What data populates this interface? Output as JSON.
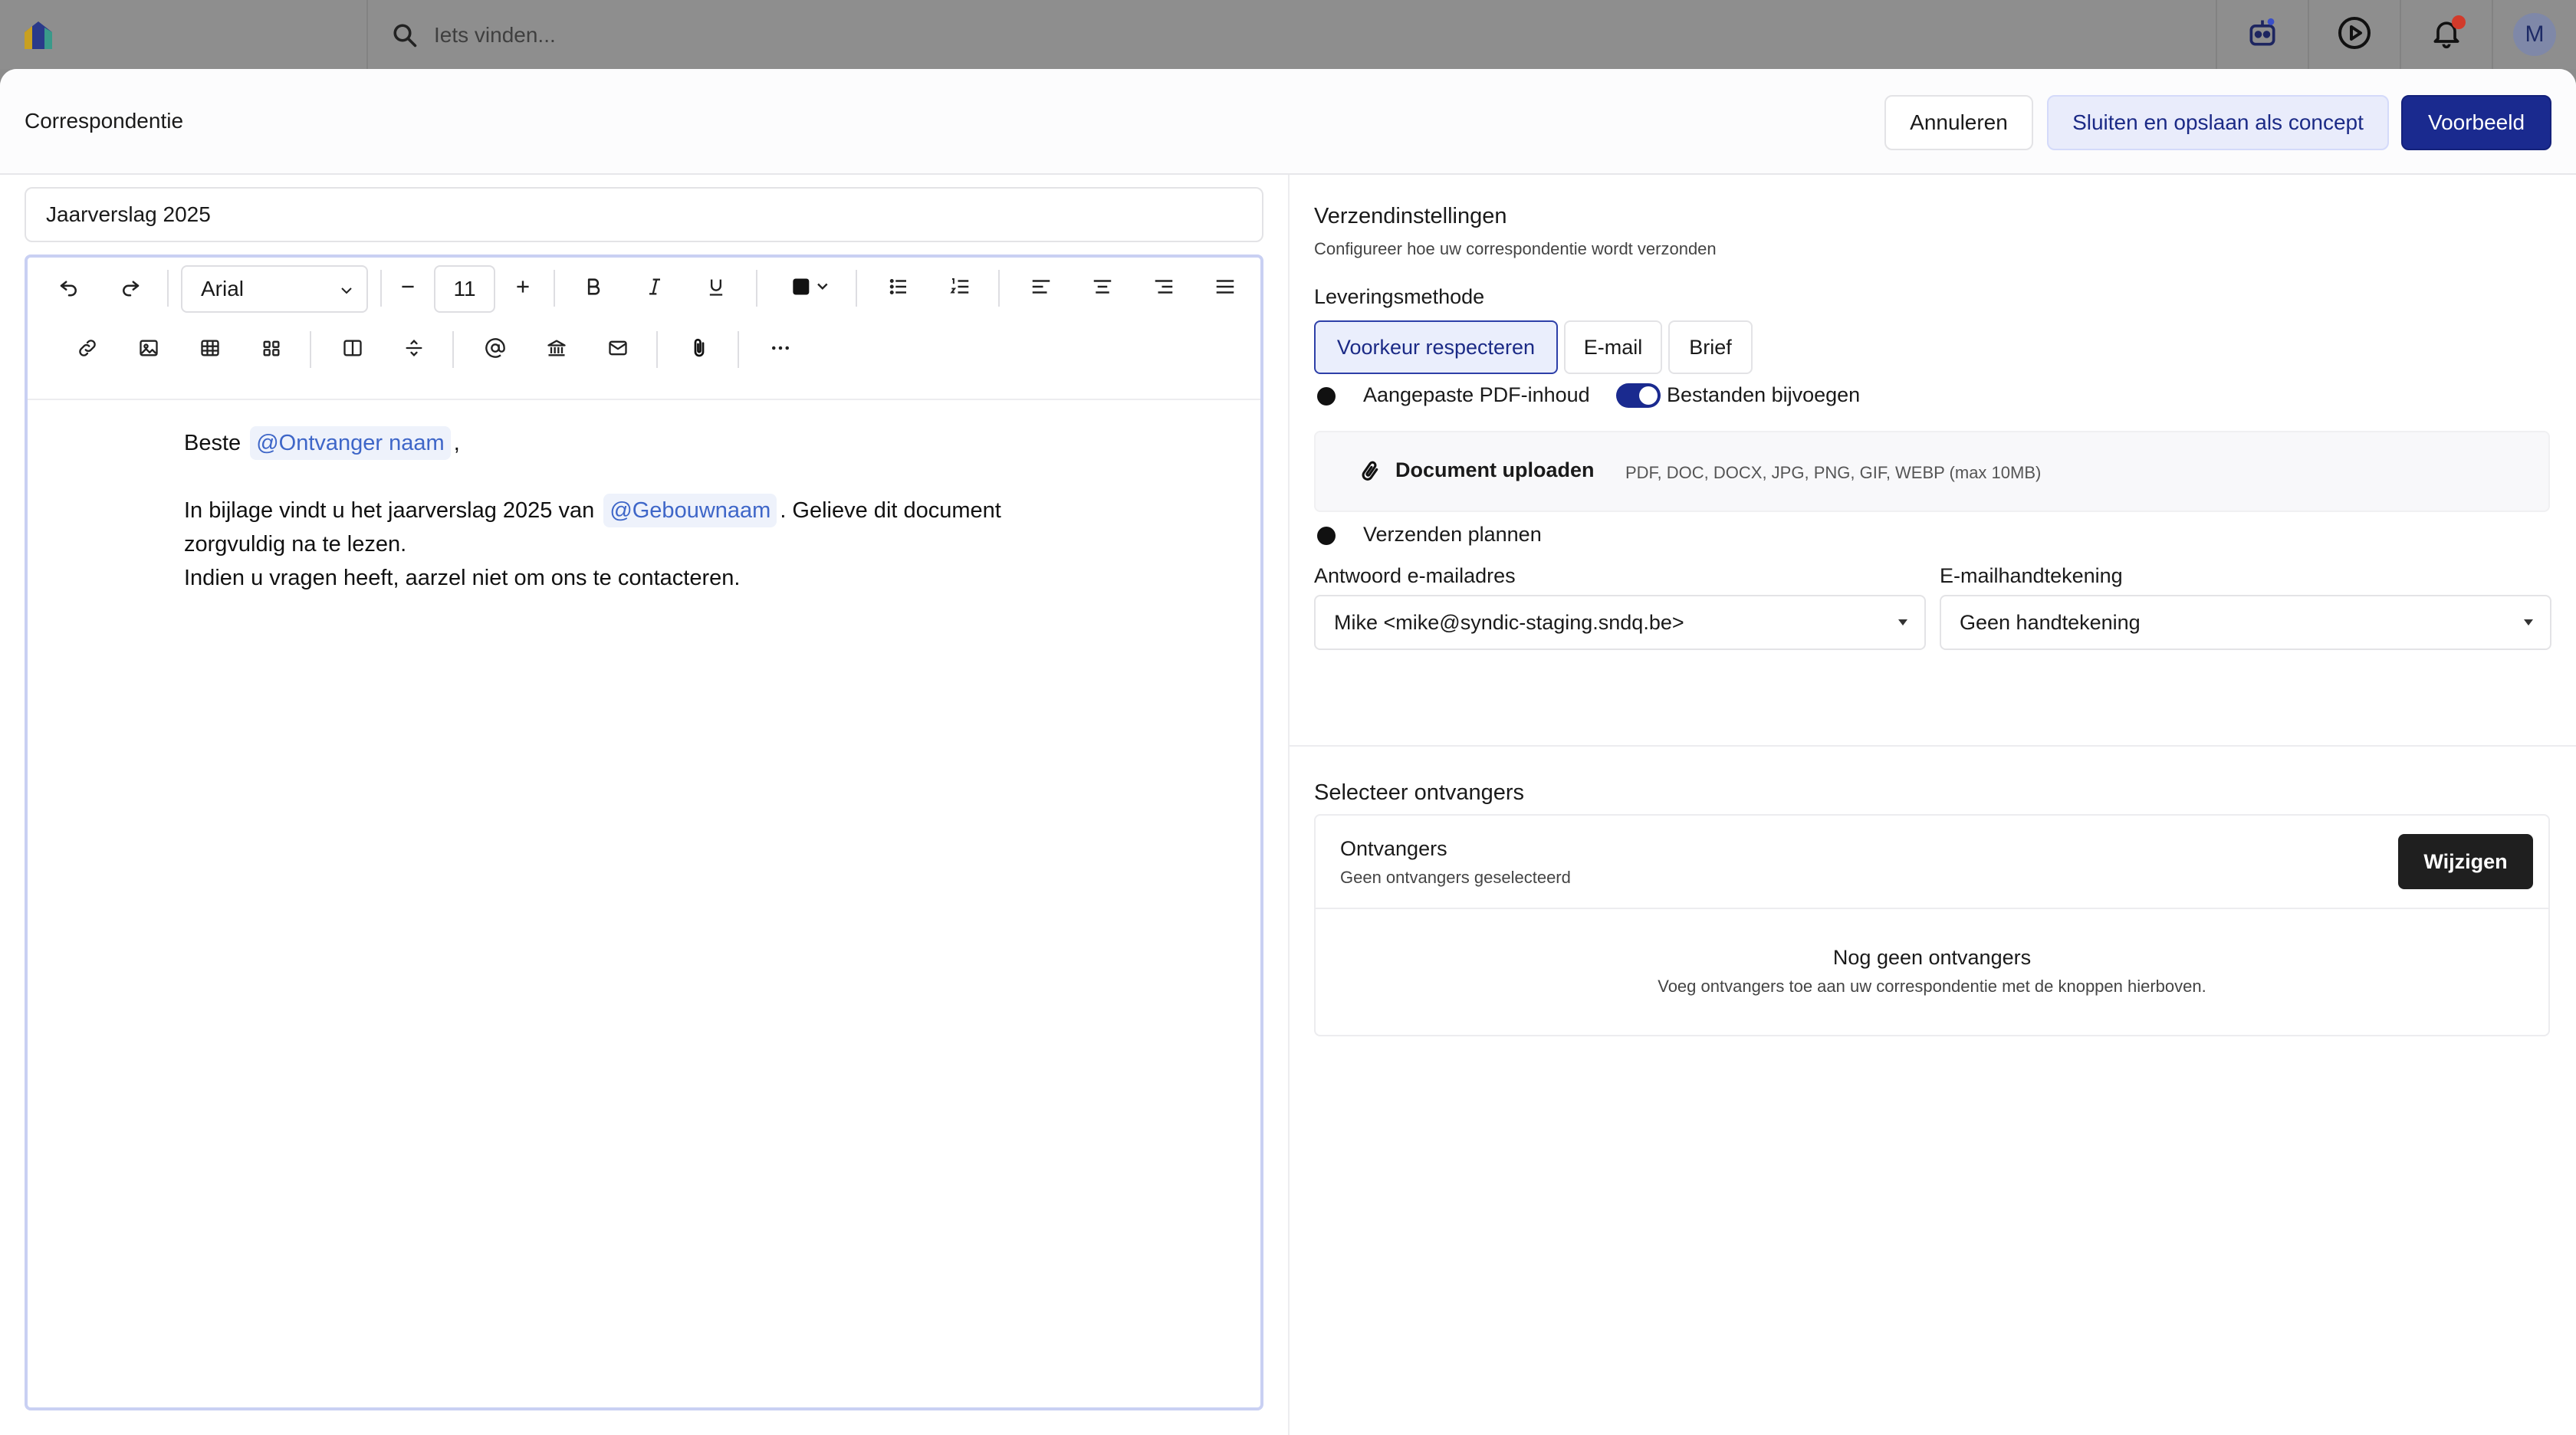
{
  "topbar": {
    "search_placeholder": "Iets vinden...",
    "avatar_initial": "M"
  },
  "modal": {
    "title": "Correspondentie",
    "cancel_label": "Annuleren",
    "draft_label": "Sluiten en opslaan als concept",
    "preview_label": "Voorbeeld"
  },
  "editor": {
    "subject": "Jaarverslag 2025",
    "font": "Arial",
    "font_size": "11",
    "body": {
      "greeting": "Beste",
      "mention_recipient": "@Ontvanger naam",
      "greeting_comma": ",",
      "line1_start": "In bijlage vindt u het jaarverslag 2025 van",
      "mention_building": "@Gebouwnaam",
      "line1_end": ". Gelieve dit document",
      "line2": "zorgvuldig na te lezen.",
      "line3": "Indien u vragen heeft, aarzel niet om ons te contacteren."
    }
  },
  "settings": {
    "title": "Verzendinstellingen",
    "subtitle": "Configureer hoe uw correspondentie wordt verzonden",
    "delivery_label": "Leveringsmethode",
    "delivery_options": [
      "Voorkeur respecteren",
      "E-mail",
      "Brief"
    ],
    "delivery_selected": "Voorkeur respecteren",
    "custom_pdf_label": "Aangepaste PDF-inhoud",
    "custom_pdf_on": false,
    "attach_files_label": "Bestanden bijvoegen",
    "attach_files_on": true,
    "upload_label": "Document uploaden",
    "upload_hint": "PDF, DOC, DOCX, JPG, PNG, GIF, WEBP (max 10MB)",
    "schedule_label": "Verzenden plannen",
    "schedule_on": false,
    "reply_label": "Antwoord e-mailadres",
    "reply_value": "Mike <mike@syndic-staging.sndq.be>",
    "signature_label": "E-mailhandtekening",
    "signature_value": "Geen handtekening"
  },
  "recipients": {
    "title": "Selecteer ontvangers",
    "card_title": "Ontvangers",
    "card_sub": "Geen ontvangers geselecteerd",
    "change_label": "Wijzigen",
    "empty_title": "Nog geen ontvangers",
    "empty_sub": "Voeg ontvangers toe aan uw correspondentie met de knoppen hierboven."
  },
  "colors": {
    "primary": "#1a2a8f",
    "mention_text": "#3e66c8",
    "mention_bg": "#eef2fb",
    "notification_dot": "#d23a2a"
  }
}
